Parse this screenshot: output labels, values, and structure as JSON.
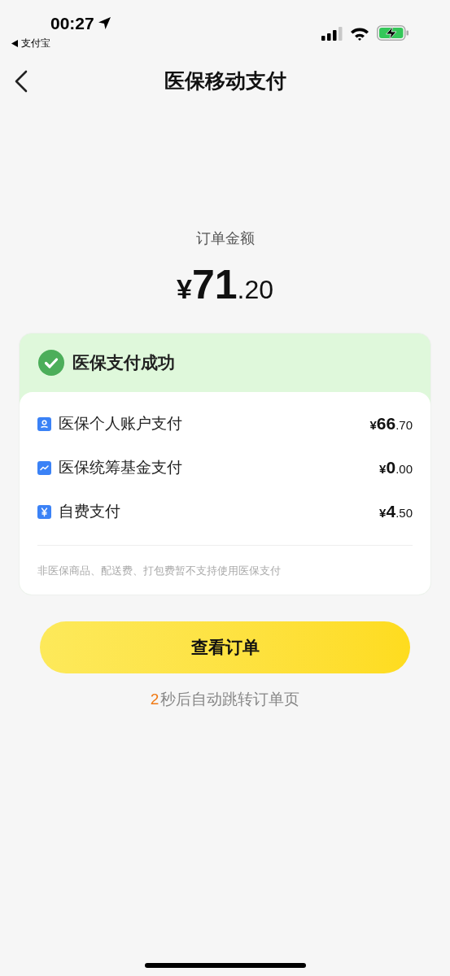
{
  "status_bar": {
    "time": "00:27",
    "back_app": "支付宝"
  },
  "nav": {
    "title": "医保移动支付"
  },
  "order": {
    "label": "订单金额",
    "currency": "¥",
    "integer": "71",
    "decimal": ".20"
  },
  "result": {
    "title": "医保支付成功",
    "items": [
      {
        "kind": "person",
        "label": "医保个人账户支付",
        "currency": "¥",
        "integer": "66",
        "decimal": ".70"
      },
      {
        "kind": "chart",
        "label": "医保统筹基金支付",
        "currency": "¥",
        "integer": "0",
        "decimal": ".00"
      },
      {
        "kind": "yen",
        "label": "自费支付",
        "currency": "¥",
        "integer": "4",
        "decimal": ".50"
      }
    ],
    "note": "非医保商品、配送费、打包费暂不支持使用医保支付"
  },
  "button": {
    "label": "查看订单"
  },
  "countdown": {
    "seconds": "2",
    "text": "秒后自动跳转订单页"
  }
}
